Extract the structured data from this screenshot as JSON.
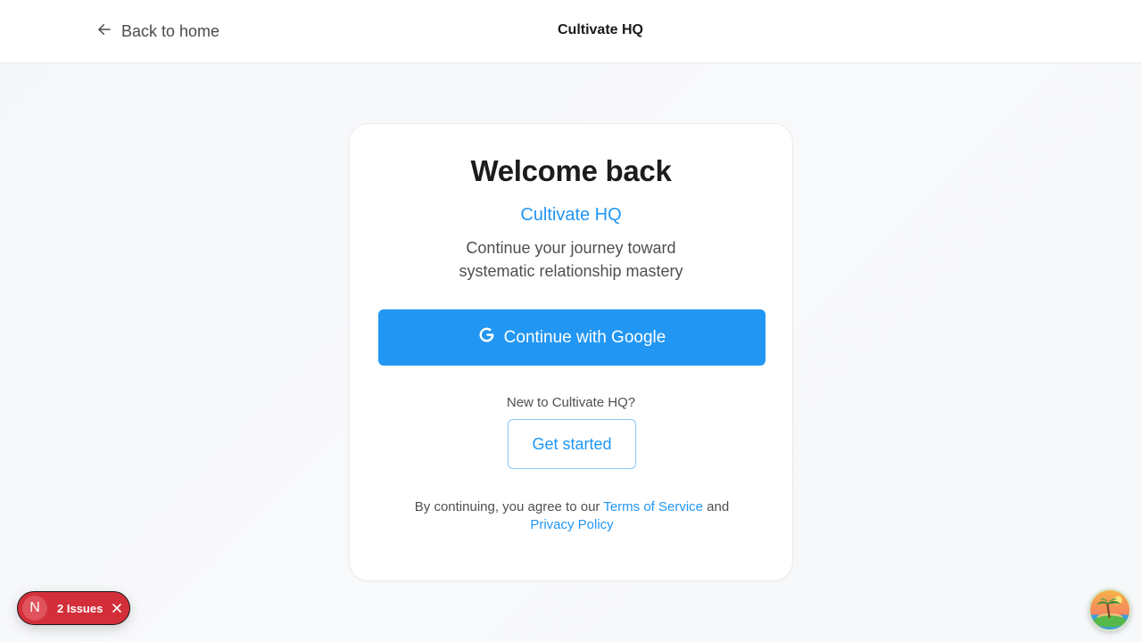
{
  "header": {
    "back_label": "Back to home",
    "brand": "Cultivate HQ",
    "back_icon": "arrow-left-icon"
  },
  "card": {
    "title": "Welcome back",
    "brand": "Cultivate HQ",
    "tagline_line1": "Continue your journey toward",
    "tagline_line2": "systematic relationship mastery",
    "google_button_label": "Continue with Google",
    "google_icon": "google-icon",
    "new_user_text": "New to Cultivate HQ?",
    "get_started_label": "Get started",
    "legal": {
      "prefix": "By continuing, you agree to our ",
      "terms_link": "Terms of Service",
      "middle": " and",
      "privacy_link": "Privacy Policy"
    }
  },
  "dev_overlay": {
    "badge_letter": "N",
    "issues_label": "2 Issues",
    "close_icon": "close-icon"
  },
  "extension": {
    "icon": "island-avatar-icon"
  },
  "colors": {
    "accent": "#2196f3",
    "issues_red": "#d32f3a",
    "header_bg": "#ffffff"
  }
}
